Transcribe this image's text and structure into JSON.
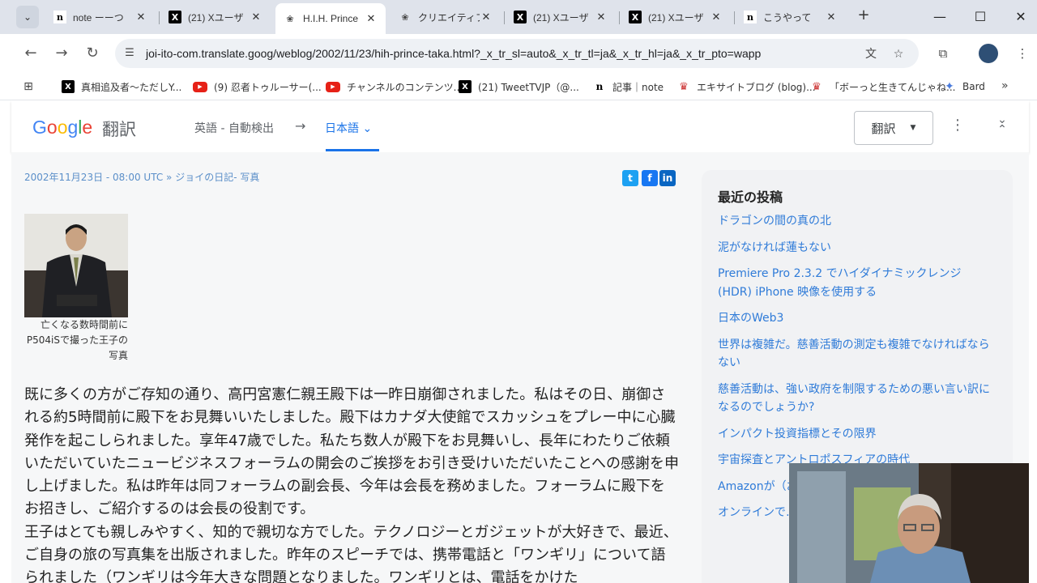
{
  "browser": {
    "tabs": [
      {
        "favicon": "note-icon",
        "title": "note ーーつ"
      },
      {
        "favicon": "x-icon",
        "title": "(21) Xユーザ"
      },
      {
        "favicon": "cc-icon",
        "title": "H.I.H. Prince",
        "active": true
      },
      {
        "favicon": "cc-icon",
        "title": "クリエイティブ"
      },
      {
        "favicon": "x-icon",
        "title": "(21) Xユーザ"
      },
      {
        "favicon": "x-icon",
        "title": "(21) Xユーザ"
      },
      {
        "favicon": "note-icon",
        "title": "こうやって"
      }
    ],
    "url": "joi-ito-com.translate.goog/weblog/2002/11/23/hih-prince-taka.html?_x_tr_sl=auto&_x_tr_tl=ja&_x_tr_hl=ja&_x_tr_pto=wapp",
    "bookmarks": [
      {
        "favicon": "x-icon",
        "label": "真相追及者～ただしY..."
      },
      {
        "favicon": "youtube-icon",
        "label": "(9) 忍者トゥルーサー(..."
      },
      {
        "favicon": "youtube-icon",
        "label": "チャンネルのコンテンツ..."
      },
      {
        "favicon": "x-icon",
        "label": "(21) TweetTVJP（@..."
      },
      {
        "favicon": "note-icon",
        "label": "記事｜note"
      },
      {
        "favicon": "excite-icon",
        "label": "エキサイトブログ (blog)..."
      },
      {
        "favicon": "excite-icon",
        "label": "「ボーっと生きてんじゃね..."
      },
      {
        "favicon": "bard-icon",
        "label": "Bard"
      }
    ]
  },
  "translate": {
    "logo_word": "翻訳",
    "source_lang": "英語 - 自動検出",
    "arrow": "→",
    "target_lang": "日本語",
    "translate_button": "翻訳"
  },
  "post": {
    "meta": "2002年11月23日 - 08:00 UTC » ジョイの日記- 写真",
    "caption": "亡くなる数時間前にP504iSで撮った王子の写真",
    "paragraphs": [
      "既に多くの方がご存知の通り、高円宮憲仁親王殿下は一昨日崩御されました。私はその日、崩御される約5時間前に殿下をお見舞いいたしました。殿下はカナダ大使館でスカッシュをプレー中に心臓発作を起こしられました。享年47歳でした。私たち数人が殿下をお見舞いし、長年にわたりご依頼いただいていたニュービジネスフォーラムの開会のご挨拶をお引き受けいただいたことへの感謝を申し上げました。私は昨年は同フォーラムの副会長、今年は会長を務めました。フォーラムに殿下をお招きし、ご紹介するのは会長の役割です。",
      "王子はとても親しみやすく、知的で親切な方でした。テクノロジーとガジェットが大好きで、最近、ご自身の旅の写真集を出版されました。昨年のスピーチでは、携帯電話と「ワンギリ」について語られました（ワンギリは今年大きな問題となりました。ワンギリとは、電話をかけた"
    ]
  },
  "sidebar": {
    "title": "最近の投稿",
    "items": [
      "ドラゴンの間の真の北",
      "泥がなければ蓮もない",
      "Premiere Pro 2.3.2 でハイダイナミックレンジ (HDR) iPhone 映像を使用する",
      "日本のWeb3",
      "世界は複雑だ。慈善活動の測定も複雑でなければならない",
      "慈善活動は、強い政府を制限するための悪い言い訳になるのでしょうか?",
      "インパクト投資指標とその限界",
      "宇宙探査とアントロポスフィアの時代",
      "Amazonが（お…は問題ない",
      "オンラインで…するために"
    ]
  }
}
